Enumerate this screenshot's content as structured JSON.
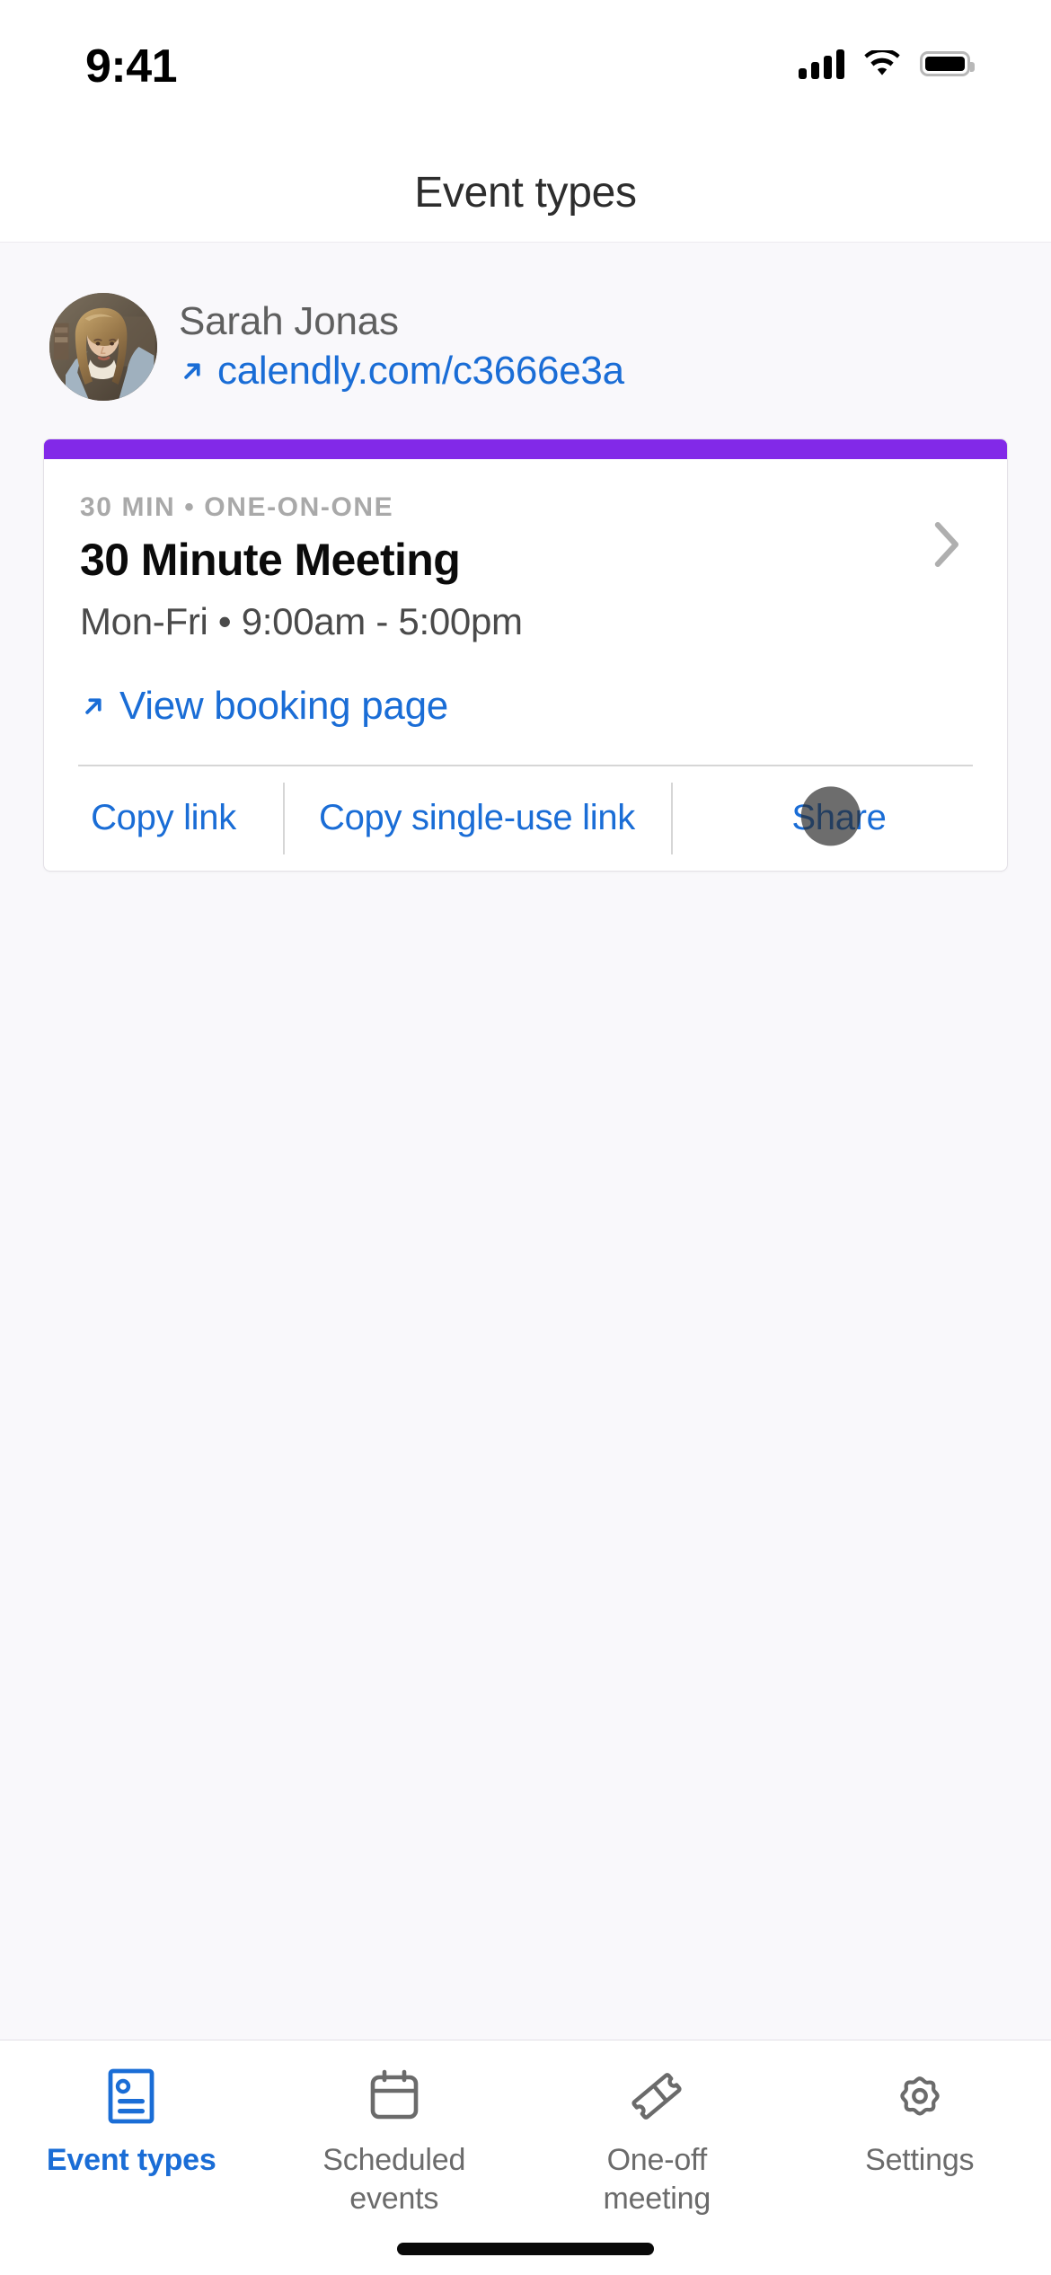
{
  "status_bar": {
    "time": "9:41",
    "cellular_icon": "cellular-signal-icon",
    "wifi_icon": "wifi-icon",
    "battery_icon": "battery-full-icon"
  },
  "header": {
    "title": "Event types"
  },
  "profile": {
    "avatar_icon": "user-avatar-photo",
    "name": "Sarah Jonas",
    "link_icon": "external-link-arrow-icon",
    "link": "calendly.com/c3666e3a"
  },
  "event_card": {
    "accent_color": "#8229E8",
    "meta": "30 MIN • ONE-ON-ONE",
    "title": "30 Minute Meeting",
    "availability": "Mon-Fri • 9:00am - 5:00pm",
    "chevron_icon": "chevron-right-icon",
    "booking_icon": "external-link-arrow-icon",
    "booking_label": "View booking page",
    "actions": {
      "copy_link": "Copy link",
      "copy_single_use": "Copy single-use link",
      "share": "Share"
    },
    "link_color": "#1A6DD6"
  },
  "tab_bar": {
    "active_color": "#1A6DD6",
    "inactive_color": "#6B6B6B",
    "tabs": [
      {
        "label": "Event types",
        "icon": "event-types-card-icon",
        "active": true
      },
      {
        "label": "Scheduled events",
        "icon": "calendar-icon",
        "active": false
      },
      {
        "label": "One-off meeting",
        "icon": "ticket-icon",
        "active": false
      },
      {
        "label": "Settings",
        "icon": "gear-icon",
        "active": false
      }
    ]
  }
}
